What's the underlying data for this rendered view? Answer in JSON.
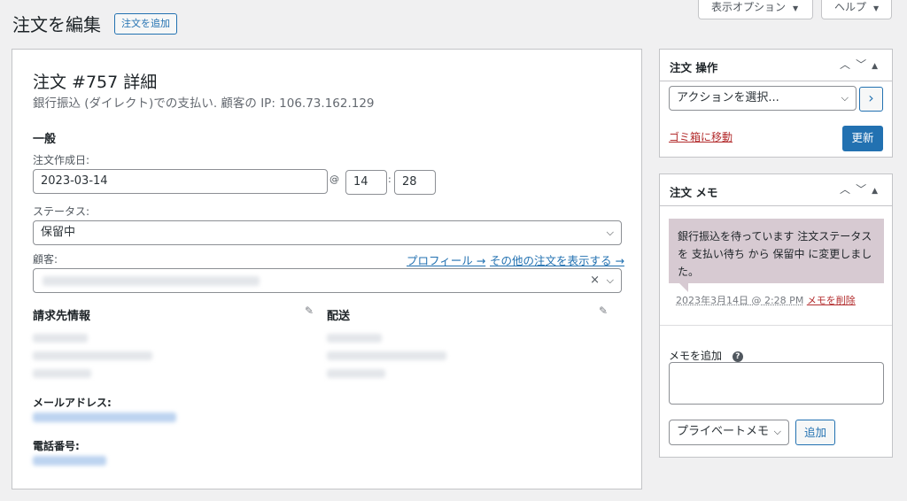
{
  "header": {
    "title": "注文を編集",
    "add_order": "注文を追加",
    "screen_options": "表示オプション",
    "help": "ヘルプ"
  },
  "order": {
    "heading": "注文 #757 詳細",
    "subtitle": "銀行振込 (ダイレクト)での支払い. 顧客の IP: 106.73.162.129",
    "general_title": "一般",
    "date_label": "注文作成日:",
    "date_value": "2023-03-14",
    "at_symbol": "@",
    "hour": "14",
    "colon": ":",
    "minute": "28",
    "status_label": "ステータス:",
    "status_value": "保留中",
    "customer_label": "顧客:",
    "profile_link": "プロフィール →",
    "other_orders_link": "その他の注文を表示する →",
    "clear_symbol": "×",
    "billing_title": "請求先情報",
    "shipping_title": "配送",
    "email_label": "メールアドレス:",
    "phone_label": "電話番号:"
  },
  "actions_panel": {
    "title": "注文 操作",
    "select_placeholder": "アクションを選択...",
    "go_symbol": "›",
    "trash_link": "ゴミ箱に移動",
    "update_button": "更新"
  },
  "notes_panel": {
    "title": "注文 メモ",
    "note_text": "銀行振込を待っています 注文ステータスを 支払い待ち から 保留中 に変更しました。",
    "note_date": "2023年3月14日 @ 2:28 PM",
    "delete_link": "メモを削除",
    "add_note_label": "メモを追加",
    "help_glyph": "?",
    "note_type": "プライベートメモ",
    "add_button": "追加"
  },
  "icons": {
    "chevron_down": "chevron-down-icon",
    "pencil": "pencil-icon",
    "panel_up": "chevron-up-icon",
    "panel_toggle": "triangle-up-icon"
  },
  "colors": {
    "accent": "#2271b1",
    "danger": "#b32d2e",
    "note_bg": "#d7cad2",
    "page_bg": "#f0f0f1"
  }
}
